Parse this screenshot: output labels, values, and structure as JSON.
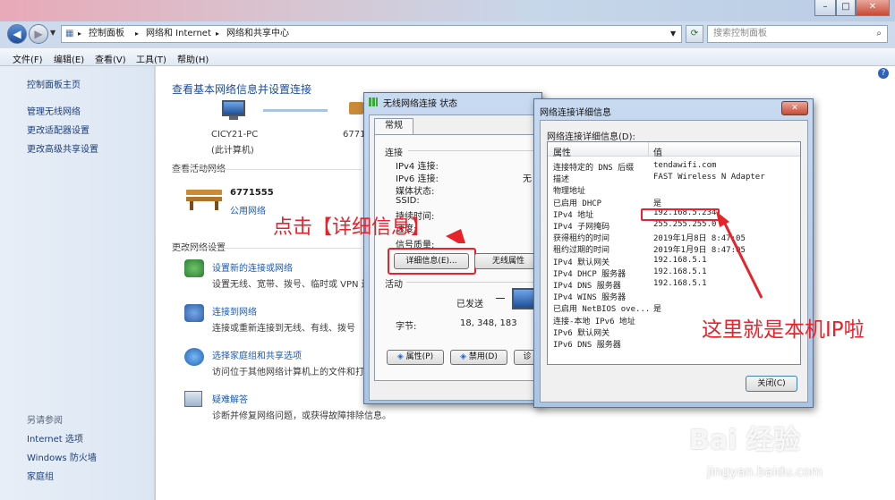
{
  "nav": {
    "breadcrumb": [
      "控制面板",
      "网络和 Internet",
      "网络和共享中心"
    ],
    "search_placeholder": "搜索控制面板"
  },
  "menubar": [
    "文件(F)",
    "编辑(E)",
    "查看(V)",
    "工具(T)",
    "帮助(H)"
  ],
  "sidebar": {
    "home": "控制面板主页",
    "items": [
      "管理无线网络",
      "更改适配器设置",
      "更改高级共享设置"
    ],
    "see_also_title": "另请参阅",
    "see_also": [
      "Internet 选项",
      "Windows 防火墙",
      "家庭组"
    ]
  },
  "main": {
    "title": "查看基本网络信息并设置连接",
    "pc_name": "CICY21-PC",
    "pc_sub": "(此计算机)",
    "net_short": "6771",
    "active_title": "查看活动网络",
    "network_name": "6771555",
    "network_type": "公用网络",
    "change_title": "更改网络设置",
    "tasks": [
      {
        "link": "设置新的连接或网络",
        "desc": "设置无线、宽带、拨号、临时或 VPN 连"
      },
      {
        "link": "连接到网络",
        "desc": "连接或重新连接到无线、有线、拨号"
      },
      {
        "link": "选择家庭组和共享选项",
        "desc": "访问位于其他网络计算机上的文件和打"
      },
      {
        "link": "疑难解答",
        "desc": "诊断并修复网络问题，或获得故障排除信息。"
      }
    ]
  },
  "status_dialog": {
    "title": "无线网络连接 状态",
    "tab": "常规",
    "group_connection": "连接",
    "rows": [
      "IPv4 连接:",
      "IPv6 连接:",
      "媒体状态:",
      "SSID:",
      "持续时间:",
      "速度:",
      "信号质量:"
    ],
    "ipv6_value": "无",
    "details_button": "详细信息(E)...",
    "wireless_props": "无线属性",
    "group_activity": "活动",
    "sent_label": "已发送",
    "bytes_label": "字节:",
    "bytes_value": "18, 348, 183",
    "props_button": "属性(P)",
    "disable_button": "禁用(D)",
    "diag_button": "诊"
  },
  "details_dialog": {
    "title": "网络连接详细信息",
    "heading": "网络连接详细信息(D):",
    "col_prop": "属性",
    "col_value": "值",
    "rows": [
      {
        "prop": "连接特定的 DNS 后缀",
        "value": "tendawifi.com"
      },
      {
        "prop": "描述",
        "value": "FAST Wireless N Adapter"
      },
      {
        "prop": "物理地址",
        "value": ""
      },
      {
        "prop": "已启用 DHCP",
        "value": "是"
      },
      {
        "prop": "IPv4 地址",
        "value": "192.168.5.234"
      },
      {
        "prop": "IPv4 子网掩码",
        "value": "255.255.255.0"
      },
      {
        "prop": "获得租约的时间",
        "value": "2019年1月8日 8:47:05"
      },
      {
        "prop": "租约过期的时间",
        "value": "2019年1月9日 8:47:05"
      },
      {
        "prop": "IPv4 默认网关",
        "value": "192.168.5.1"
      },
      {
        "prop": "IPv4 DHCP 服务器",
        "value": "192.168.5.1"
      },
      {
        "prop": "IPv4 DNS 服务器",
        "value": "192.168.5.1"
      },
      {
        "prop": "IPv4 WINS 服务器",
        "value": ""
      },
      {
        "prop": "已启用 NetBIOS ove...",
        "value": "是"
      },
      {
        "prop": "连接-本地 IPv6 地址",
        "value": ""
      },
      {
        "prop": "IPv6 默认网关",
        "value": ""
      },
      {
        "prop": "IPv6 DNS 服务器",
        "value": ""
      }
    ],
    "close_button": "关闭(C)"
  },
  "annotations": {
    "click_details": "点击【详细信息】",
    "ip_here": "这里就是本机IP啦"
  },
  "watermark": {
    "brand": "Bai 经验",
    "url": "jingyan.baidu.com"
  },
  "colors": {
    "annotation": "#e8222b",
    "link": "#1a5bb8",
    "title": "#1f4b99"
  }
}
